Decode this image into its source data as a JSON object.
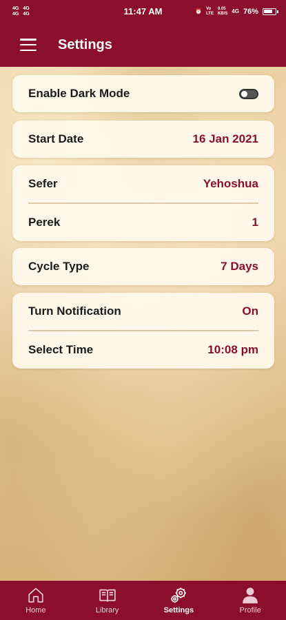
{
  "status_bar": {
    "left_text_1": "4G\n4G",
    "left_text_2": "4G\n4G",
    "time": "11:47 AM",
    "net_1": "Vo\nLTE",
    "net_2": "0.05\nKB/S",
    "net_3": "4G",
    "battery": "76%"
  },
  "app_bar": {
    "title": "Settings",
    "menu_icon": "hamburger-menu-icon"
  },
  "settings": {
    "dark_mode": {
      "label": "Enable Dark Mode",
      "enabled": false
    },
    "start_date": {
      "label": "Start Date",
      "value": "16 Jan 2021"
    },
    "sefer": {
      "label": "Sefer",
      "value": "Yehoshua"
    },
    "perek": {
      "label": "Perek",
      "value": "1"
    },
    "cycle_type": {
      "label": "Cycle Type",
      "value": "7 Days"
    },
    "notification": {
      "label": "Turn Notification",
      "value": "On"
    },
    "select_time": {
      "label": "Select Time",
      "value": "10:08 pm"
    }
  },
  "bottom_nav": {
    "items": [
      {
        "label": "Home",
        "icon": "home-icon",
        "active": false
      },
      {
        "label": "Library",
        "icon": "book-icon",
        "active": false
      },
      {
        "label": "Settings",
        "icon": "gears-icon",
        "active": true
      },
      {
        "label": "Profile",
        "icon": "person-icon",
        "active": false
      }
    ]
  },
  "colors": {
    "primary": "#8b0f2c",
    "card_background": "#fffaee",
    "value_text": "#8b0f2c",
    "label_text": "#1c1c1c"
  }
}
